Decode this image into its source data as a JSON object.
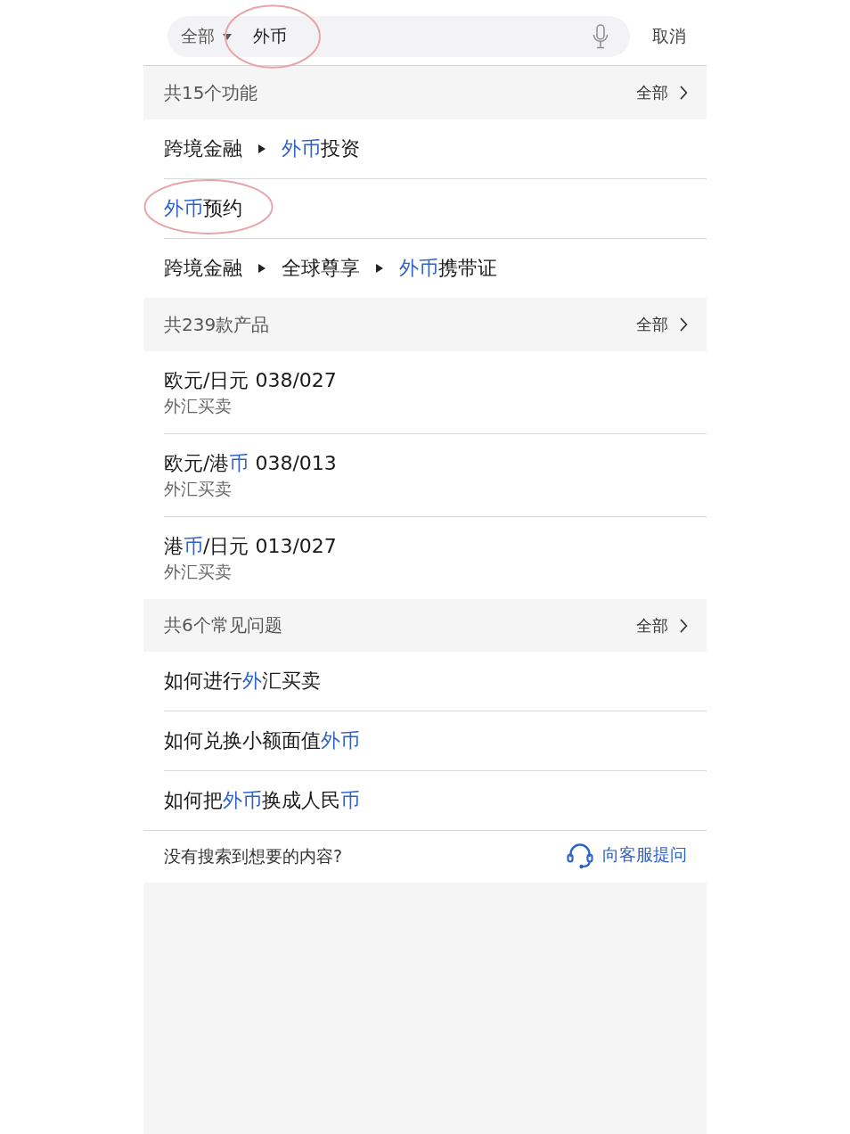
{
  "search": {
    "scope": "全部",
    "value": "外币",
    "circled": true,
    "cancel": "取消"
  },
  "sections": [
    {
      "kind": "functions",
      "title": "共15个功能",
      "more": "全部",
      "items": [
        {
          "circled": false,
          "path": [
            [
              {
                "text": "跨境金融",
                "highlighted": false
              }
            ],
            [
              {
                "text": "外币",
                "highlighted": true
              },
              {
                "text": "投资",
                "highlighted": false
              }
            ]
          ]
        },
        {
          "circled": true,
          "path": [
            [
              {
                "text": "外币",
                "highlighted": true
              },
              {
                "text": "预约",
                "highlighted": false
              }
            ]
          ]
        },
        {
          "circled": false,
          "path": [
            [
              {
                "text": "跨境金融",
                "highlighted": false
              }
            ],
            [
              {
                "text": "全球尊享",
                "highlighted": false
              }
            ],
            [
              {
                "text": "外币",
                "highlighted": true
              },
              {
                "text": "携带证",
                "highlighted": false
              }
            ]
          ]
        }
      ]
    },
    {
      "kind": "products",
      "title": "共239款产品",
      "more": "全部",
      "items": [
        {
          "name": [
            {
              "text": "欧元/日元 038/027",
              "highlighted": false
            }
          ],
          "category": "外汇买卖"
        },
        {
          "name": [
            {
              "text": "欧元/港",
              "highlighted": false
            },
            {
              "text": "币",
              "highlighted": true
            },
            {
              "text": " 038/013",
              "highlighted": false
            }
          ],
          "category": "外汇买卖"
        },
        {
          "name": [
            {
              "text": "港",
              "highlighted": false
            },
            {
              "text": "币",
              "highlighted": true
            },
            {
              "text": "/日元 013/027",
              "highlighted": false
            }
          ],
          "category": "外汇买卖"
        }
      ]
    },
    {
      "kind": "faq",
      "title": "共6个常见问题",
      "more": "全部",
      "items": [
        {
          "question": [
            {
              "text": "如何进行",
              "highlighted": false
            },
            {
              "text": "外",
              "highlighted": true
            },
            {
              "text": "汇买卖",
              "highlighted": false
            }
          ]
        },
        {
          "question": [
            {
              "text": "如何兑换小额面值",
              "highlighted": false
            },
            {
              "text": "外币",
              "highlighted": true
            }
          ]
        },
        {
          "question": [
            {
              "text": "如何把",
              "highlighted": false
            },
            {
              "text": "外币",
              "highlighted": true
            },
            {
              "text": "换成人民",
              "highlighted": false
            },
            {
              "text": "币",
              "highlighted": true
            }
          ]
        }
      ]
    }
  ],
  "footer": {
    "prompt": "没有搜索到想要的内容?",
    "action": "向客服提问"
  }
}
